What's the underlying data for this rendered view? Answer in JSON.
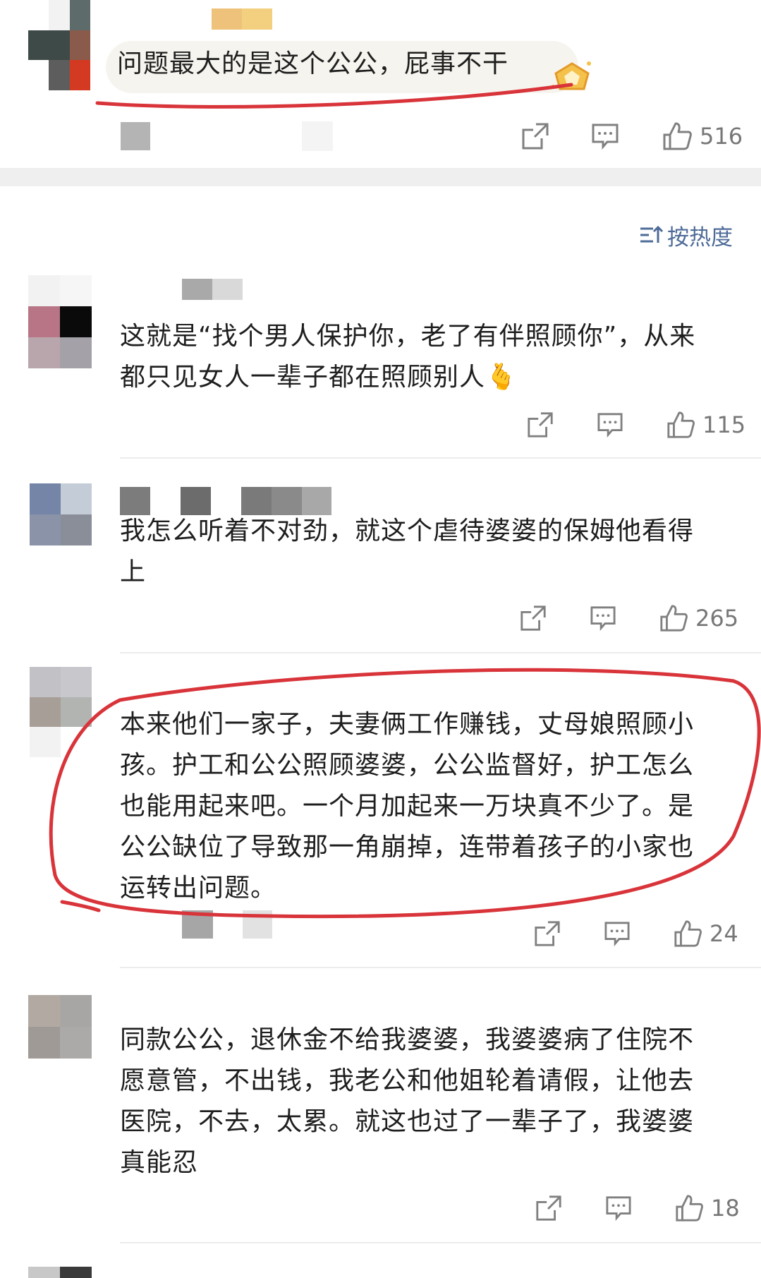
{
  "sort": {
    "label": "按热度"
  },
  "comments": [
    {
      "text": "问题最大的是这个公公，屁事不干",
      "likes": "516",
      "avatar_colors": [
        "#ffffff",
        "#5d6b6a",
        "#7a7a7a",
        "#3e4a48",
        "#8a6a5a",
        "#5a4a44",
        "#ffffff",
        "#606060",
        "#d43a22"
      ],
      "name_colors": [
        "#f0f0f0",
        "#e8b66a",
        "#f3c870"
      ]
    },
    {
      "text": "这就是“找个男人保护你，老了有伴照顾你”，从来\n都只见女人一辈子都在照顾别人🫰",
      "likes": "115",
      "avatar_colors": [
        "#f2f2f2",
        "#f2f2f2",
        "#efefef",
        "#b87585",
        "#0a0a0a",
        "#ffffff",
        "#b4a2a8",
        "#a6a2a8",
        "#ffffff"
      ],
      "name_colors": [
        "#ffffff",
        "#a8a8a8",
        "#d8d8d8"
      ]
    },
    {
      "text": "我怎么听着不对劲，就这个虐待婆婆的保姆他看得\n上",
      "likes": "265",
      "avatar_colors": [
        "#f4f4f4",
        "#f4f4f4",
        "#f4f4f4",
        "#7585a8",
        "#c2ccd8",
        "#ffffff",
        "#8a93a8",
        "#8a8e98",
        "#ffffff"
      ],
      "name_colors": [
        "#7c7c7c",
        "#ffffff",
        "#6c6c6c",
        "#ffffff",
        "#7c7c7c",
        "#8a8a8a",
        "#a8a8a8"
      ]
    },
    {
      "text": "本来他们一家子，夫妻俩工作赚钱，丈母娘照顾小\n孩。护工和公公照顾婆婆，公公监督好，护工怎么\n也能用起来吧。一个月加起来一万块真不少了。是\n公公缺位了导致那一角崩掉，连带着孩子的小家也\n运转出问题。",
      "likes": "24",
      "avatar_colors": [
        "#c2c2c6",
        "#c8c8cc",
        "#f2f2f2",
        "#a89e98",
        "#b2b4b2",
        "#ffffff",
        "#f2f2f2",
        "#ffffff",
        "#ffffff"
      ],
      "name_colors": [
        "#ffffff",
        "#9a9a9a",
        "#ffffff",
        "#e2e2e2"
      ]
    },
    {
      "text": "同款公公，退休金不给我婆婆，我婆婆病了住院不\n愿意管，不出钱，我老公和他姐轮着请假，让他去\n医院，不去，太累。就这也过了一辈子了，我婆婆\n真能忍",
      "likes": "18",
      "avatar_colors": [
        "#f2f2f2",
        "#b2aaa2",
        "#a8a6a4",
        "#ffffff",
        "#a09a96",
        "#acaaa8",
        "#ffffff",
        "#ffffff",
        "#ffffff"
      ],
      "name_colors": [
        "#ffffff"
      ]
    }
  ],
  "icons": {
    "share": "share-icon",
    "comment": "comment-icon",
    "like": "thumbs-up-icon",
    "badge": "crown-badge-icon",
    "sort": "sort-icon"
  },
  "annotation_color": "#d8343a"
}
